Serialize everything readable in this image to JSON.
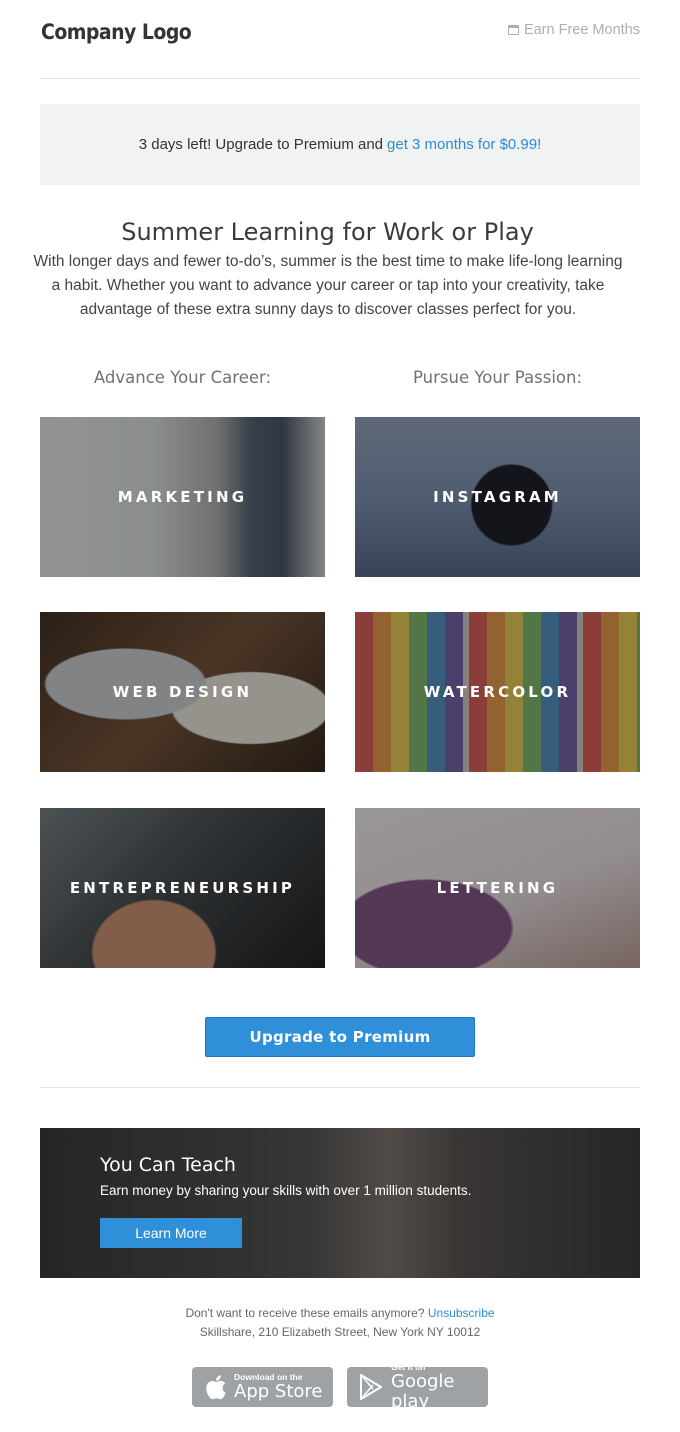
{
  "header": {
    "logo": "Company Logo",
    "earn_link": "Earn Free Months",
    "earn_icon": "calendar-icon"
  },
  "banner": {
    "text": "3 days left! Upgrade to Premium and",
    "link": "get 3 months for $0.99!"
  },
  "main": {
    "headline": "Summer Learning for Work or Play",
    "intro": "With longer days and fewer to-do’s, summer is the best time to make life-long learning a habit. Whether you want to advance your career or tap into your creativity, take advantage of these extra sunny days to discover classes perfect for you.",
    "left_heading": "Advance Your Career:",
    "right_heading": "Pursue Your Passion:"
  },
  "tiles": {
    "marketing": "MARKETING",
    "instagram": "INSTAGRAM",
    "web_design": "WEB DESIGN",
    "watercolor": "WATERCOLOR",
    "entrepreneurship": "ENTREPRENEURSHIP",
    "lettering": "LETTERING"
  },
  "cta": {
    "upgrade_label": "Upgrade to Premium"
  },
  "teach": {
    "title": "You Can Teach",
    "subtitle": "Earn money by sharing your skills with over 1 million students.",
    "button": "Learn More"
  },
  "footer": {
    "unsubscribe_prompt": "Don't want to receive these emails anymore?",
    "unsubscribe_link": "Unsubscribe",
    "address": "Skillshare, 210 Elizabeth Street, New York NY 10012"
  },
  "stores": {
    "apple_small": "Download on the",
    "apple_big": "App Store",
    "google_small": "Get it on",
    "google_big": "Google play"
  },
  "colors": {
    "accent": "#2f8fd8",
    "link": "#2b8bd6",
    "banner_bg": "#f1f3f3"
  }
}
